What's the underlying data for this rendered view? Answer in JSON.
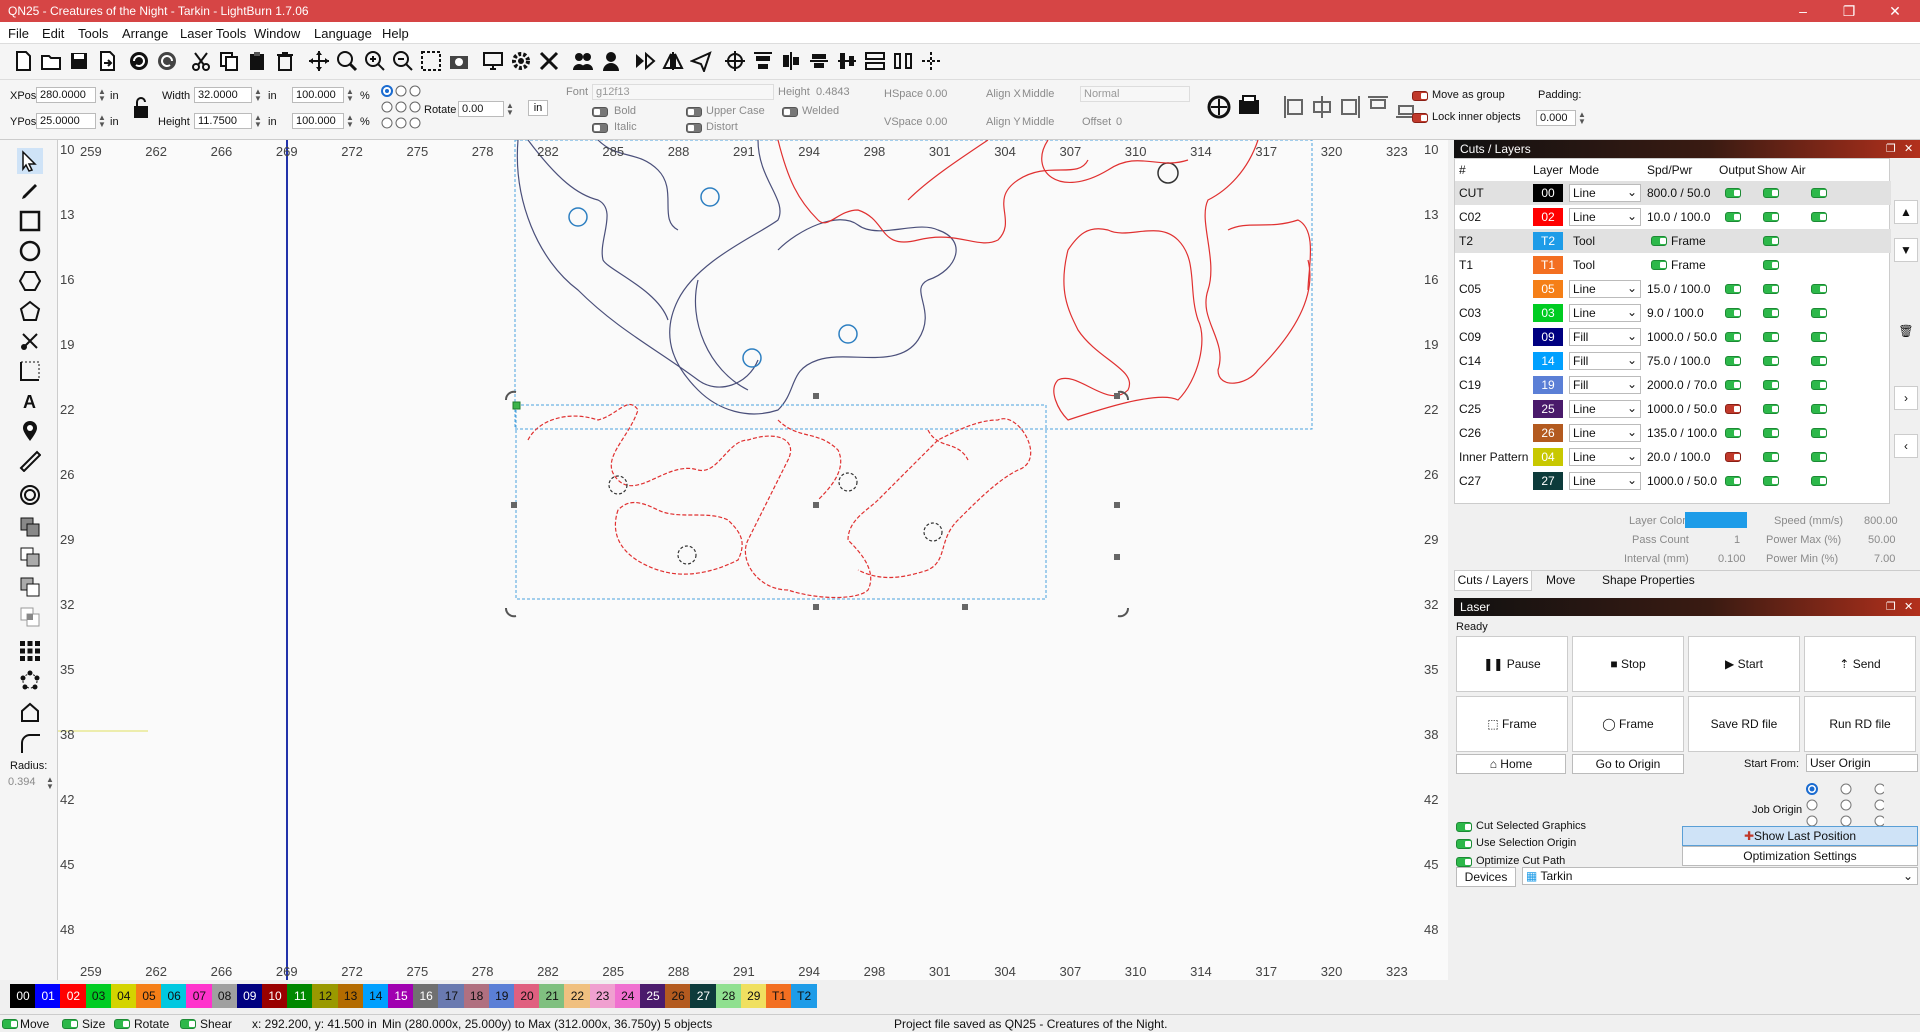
{
  "window": {
    "title": "QN25 - Creatures of the Night - Tarkin - LightBurn 1.7.06"
  },
  "menu": [
    "File",
    "Edit",
    "Tools",
    "Arrange",
    "Laser Tools",
    "Window",
    "Language",
    "Help"
  ],
  "props": {
    "xpos_label": "XPos",
    "xpos": "280.0000",
    "ypos_label": "YPos",
    "ypos": "25.0000",
    "unit": "in",
    "width_label": "Width",
    "width": "32.0000",
    "height_label": "Height",
    "height": "11.7500",
    "scale_w": "100.000",
    "scale_h": "100.000",
    "pct": "%",
    "rotate_label": "Rotate",
    "rotate": "0.00",
    "unit_btn": "in",
    "font_label": "Font",
    "font": "g12f13",
    "fheight_label": "Height",
    "fheight": "0.4843",
    "hspace_label": "HSpace",
    "hspace": "0.00",
    "vspace_label": "VSpace",
    "vspace": "0.00",
    "alignx_label": "Align X",
    "alignx": "Middle",
    "aligny_label": "Align Y",
    "aligny": "Middle",
    "normal": "Normal",
    "offset_label": "Offset",
    "offset": "0",
    "bold": "Bold",
    "italic": "Italic",
    "uppercase": "Upper Case",
    "distort": "Distort",
    "welded": "Welded",
    "move_group": "Move as group",
    "lock_inner": "Lock inner objects",
    "padding_label": "Padding:",
    "padding": "0.000"
  },
  "tools": {
    "radius_label": "Radius:",
    "radius": "0.394"
  },
  "ruler": {
    "top": [
      "259",
      "262",
      "266",
      "269",
      "272",
      "275",
      "278",
      "282",
      "285",
      "288",
      "291",
      "294",
      "298",
      "301",
      "304",
      "307",
      "310",
      "314",
      "317",
      "320",
      "323"
    ],
    "left": [
      "10",
      "13",
      "16",
      "19",
      "22",
      "26",
      "29",
      "32",
      "35",
      "38",
      "42",
      "45",
      "48"
    ],
    "right": [
      "10",
      "13",
      "16",
      "19",
      "22",
      "26",
      "29",
      "32",
      "35",
      "38",
      "42",
      "45",
      "48"
    ]
  },
  "cuts": {
    "title": "Cuts / Layers",
    "headers": [
      "#",
      "Layer",
      "Mode",
      "Spd/Pwr",
      "Output",
      "Show",
      "Air"
    ],
    "rows": [
      {
        "name": "CUT",
        "layer": "00",
        "color": "#000000",
        "mode": "Line",
        "spd": "800.0 / 50.0",
        "out": "on",
        "show": "on",
        "air": "on",
        "sel": true
      },
      {
        "name": "C02",
        "layer": "02",
        "color": "#ff0000",
        "mode": "Line",
        "spd": "10.0 / 100.0",
        "out": "on",
        "show": "on",
        "air": "on"
      },
      {
        "name": "T2",
        "layer": "T2",
        "color": "#1e9ce8",
        "mode": "Tool",
        "spd": "Frame",
        "out": "on",
        "show": "on",
        "air": "",
        "sel": true,
        "tool": true
      },
      {
        "name": "T1",
        "layer": "T1",
        "color": "#f36f21",
        "mode": "Tool",
        "spd": "Frame",
        "out": "on",
        "show": "on",
        "air": "",
        "tool": true
      },
      {
        "name": "C05",
        "layer": "05",
        "color": "#f57f17",
        "mode": "Line",
        "spd": "15.0 / 100.0",
        "out": "on",
        "show": "on",
        "air": "on"
      },
      {
        "name": "C03",
        "layer": "03",
        "color": "#00cc22",
        "mode": "Line",
        "spd": "9.0 / 100.0",
        "out": "on",
        "show": "on",
        "air": "on"
      },
      {
        "name": "C09",
        "layer": "09",
        "color": "#000080",
        "mode": "Fill",
        "spd": "1000.0 / 50.0",
        "out": "on",
        "show": "on",
        "air": "on"
      },
      {
        "name": "C14",
        "layer": "14",
        "color": "#00a0ff",
        "mode": "Fill",
        "spd": "75.0 / 100.0",
        "out": "on",
        "show": "on",
        "air": "on"
      },
      {
        "name": "C19",
        "layer": "19",
        "color": "#5b7fd6",
        "mode": "Fill",
        "spd": "2000.0 / 70.0",
        "out": "on",
        "show": "on",
        "air": "on"
      },
      {
        "name": "C25",
        "layer": "25",
        "color": "#4a1a6b",
        "mode": "Line",
        "spd": "1000.0 / 50.0",
        "out": "red",
        "show": "on",
        "air": "on"
      },
      {
        "name": "C26",
        "layer": "26",
        "color": "#b35a1f",
        "mode": "Line",
        "spd": "135.0 / 100.0",
        "out": "on",
        "show": "on",
        "air": "on"
      },
      {
        "name": "Inner Pattern",
        "layer": "04",
        "color": "#c8c800",
        "mode": "Line",
        "spd": "20.0 / 100.0",
        "out": "red",
        "show": "on",
        "air": "on"
      },
      {
        "name": "C27",
        "layer": "27",
        "color": "#0d3b3b",
        "mode": "Line",
        "spd": "1000.0 / 50.0",
        "out": "on",
        "show": "on",
        "air": "on"
      }
    ],
    "layer_color_label": "Layer Color",
    "layer_color": "#1e9ce8",
    "speed_label": "Speed (mm/s)",
    "speed": "800.00",
    "pass_label": "Pass Count",
    "pass": "1",
    "pmax_label": "Power Max (%)",
    "pmax": "50.00",
    "interval_label": "Interval (mm)",
    "interval": "0.100",
    "pmin_label": "Power Min (%)",
    "pmin": "7.00",
    "tabs": [
      "Cuts / Layers",
      "Move",
      "Shape Properties"
    ]
  },
  "laser": {
    "title": "Laser",
    "status": "Ready",
    "pause": "Pause",
    "stop": "Stop",
    "start": "Start",
    "send": "Send",
    "frame1": "Frame",
    "frame2": "Frame",
    "save_rd": "Save RD file",
    "run_rd": "Run RD file",
    "home": "Home",
    "goto_origin": "Go to Origin",
    "start_from_label": "Start From:",
    "start_from": "User Origin",
    "job_origin_label": "Job Origin",
    "cut_selected": "Cut Selected Graphics",
    "use_sel_origin": "Use Selection Origin",
    "optimize_path": "Optimize Cut Path",
    "show_last": "Show Last Position",
    "opt_settings": "Optimization Settings",
    "devices": "Devices",
    "device": "Tarkin"
  },
  "palette": [
    {
      "l": "00",
      "c": "#000000"
    },
    {
      "l": "01",
      "c": "#0000ff"
    },
    {
      "l": "02",
      "c": "#ff0000"
    },
    {
      "l": "03",
      "c": "#00cc22"
    },
    {
      "l": "04",
      "c": "#d4d400"
    },
    {
      "l": "05",
      "c": "#f57f17"
    },
    {
      "l": "06",
      "c": "#00c8e0"
    },
    {
      "l": "07",
      "c": "#ff33cc"
    },
    {
      "l": "08",
      "c": "#a0a0a0"
    },
    {
      "l": "09",
      "c": "#000080"
    },
    {
      "l": "10",
      "c": "#990000"
    },
    {
      "l": "11",
      "c": "#008800"
    },
    {
      "l": "12",
      "c": "#999900"
    },
    {
      "l": "13",
      "c": "#b36b00"
    },
    {
      "l": "14",
      "c": "#00a0ff"
    },
    {
      "l": "15",
      "c": "#a000b0"
    },
    {
      "l": "16",
      "c": "#707070"
    },
    {
      "l": "17",
      "c": "#6a7ab0"
    },
    {
      "l": "18",
      "c": "#b07080"
    },
    {
      "l": "19",
      "c": "#5b7fd6"
    },
    {
      "l": "20",
      "c": "#e06080"
    },
    {
      "l": "21",
      "c": "#80c080"
    },
    {
      "l": "22",
      "c": "#f0c080"
    },
    {
      "l": "23",
      "c": "#f0a0d0"
    },
    {
      "l": "24",
      "c": "#f070d0"
    },
    {
      "l": "25",
      "c": "#4a1a6b"
    },
    {
      "l": "26",
      "c": "#b35a1f"
    },
    {
      "l": "27",
      "c": "#0d3b3b"
    },
    {
      "l": "28",
      "c": "#90e090"
    },
    {
      "l": "29",
      "c": "#f0e060"
    },
    {
      "l": "T1",
      "c": "#f36f21"
    },
    {
      "l": "T2",
      "c": "#1e9ce8"
    }
  ],
  "status": {
    "move": "Move",
    "size": "Size",
    "rotate": "Rotate",
    "shear": "Shear",
    "coords": "x: 292.200, y: 41.500 in",
    "bounds": "Min (280.000x, 25.000y) to Max (312.000x, 36.750y)  5 objects",
    "message": "Project file saved as QN25 - Creatures of the Night."
  }
}
